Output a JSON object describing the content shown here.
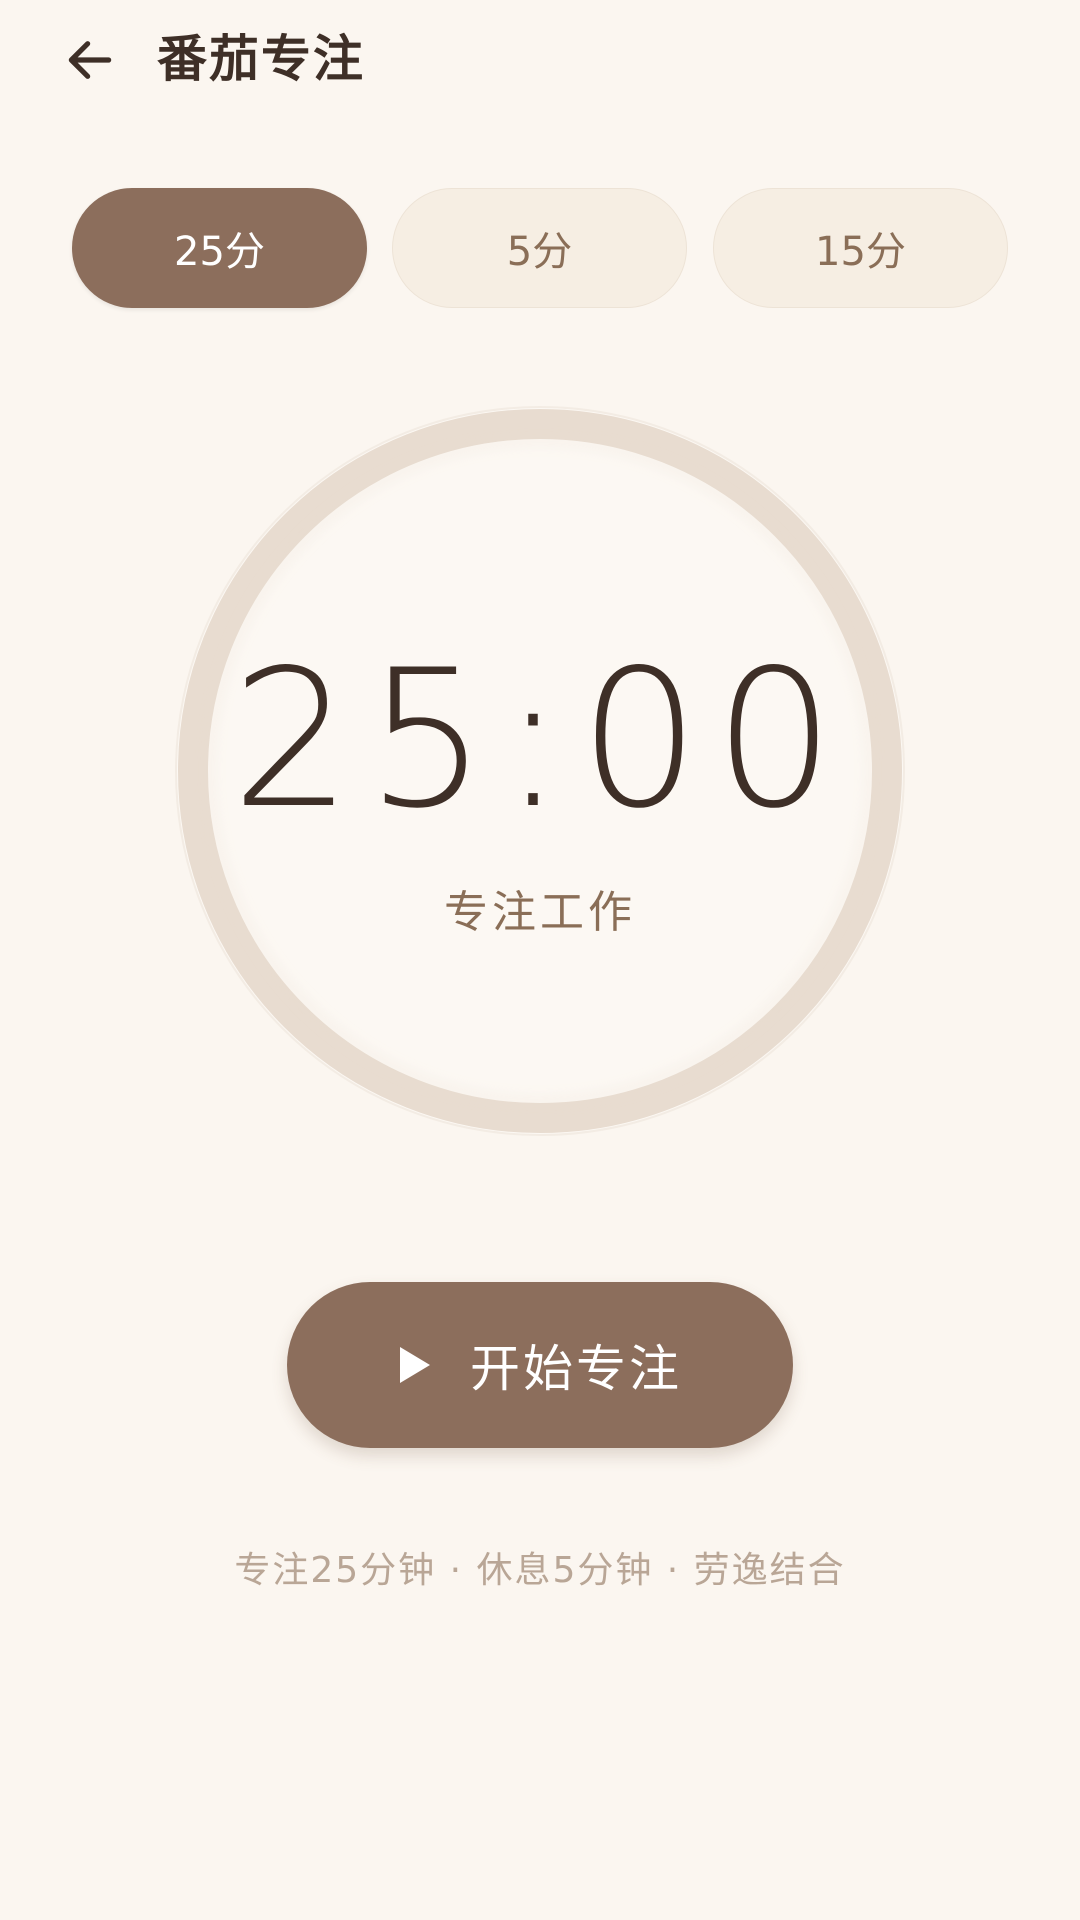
{
  "header": {
    "back_icon": "arrow-left-icon",
    "title": "番茄专注"
  },
  "tabs": [
    {
      "label": "25分",
      "active": true
    },
    {
      "label": "5分",
      "active": false
    },
    {
      "label": "15分",
      "active": false
    }
  ],
  "timer": {
    "time": "25:00",
    "mode_label": "专注工作",
    "progress": 0
  },
  "start_button": {
    "icon": "play-icon",
    "label": "开始专注"
  },
  "tip": "专注25分钟 · 休息5分钟 · 劳逸结合",
  "colors": {
    "background": "#FBF6F0",
    "accent": "#8C6E5C",
    "ring": "#E8DCD0",
    "text_primary": "#3E2F27",
    "text_secondary": "#8A6E57",
    "tip": "#B9A696"
  }
}
